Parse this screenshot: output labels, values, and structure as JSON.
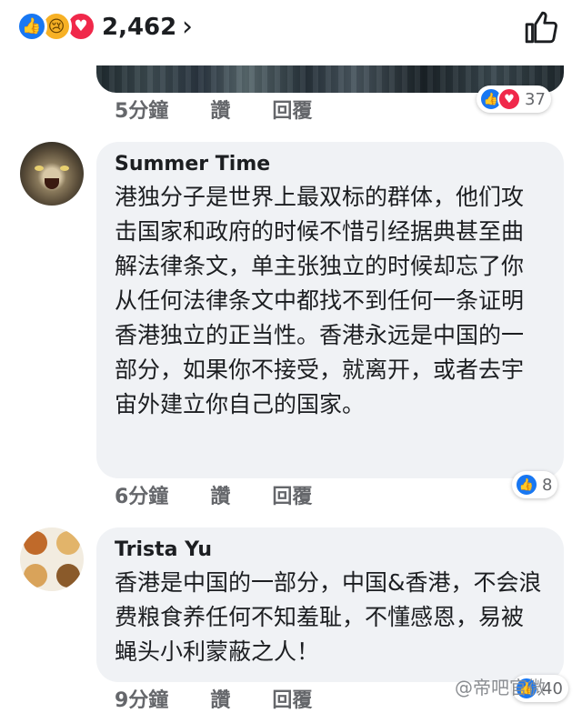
{
  "reactions_bar": {
    "icons": [
      "like-icon",
      "sad-icon",
      "love-icon"
    ],
    "count": "2,462",
    "chevron": "›"
  },
  "prev_comment": {
    "time": "5分鐘",
    "like_label": "讚",
    "reply_label": "回覆",
    "reaction_count": "37"
  },
  "comments": [
    {
      "author": "Summer Time",
      "text": "港独分子是世界上最双标的群体，他们攻击国家和政府的时候不惜引经据典甚至曲解法律条文，单主张独立的时候却忘了你从任何法律条文中都找不到任何一条证明香港独立的正当性。香港永远是中国的一部分，如果你不接受，就离开，或者去宇宙外建立你自己的国家。",
      "time": "6分鐘",
      "like_label": "讚",
      "reply_label": "回覆",
      "reaction_count": "8"
    },
    {
      "author": "Trista Yu",
      "text": "香港是中国的一部分，中国&香港，不会浪费粮食养任何不知羞耻，不懂感恩，易被蝇头小利蒙蔽之人！",
      "time": "9分鐘",
      "like_label": "讚",
      "reply_label": "回覆",
      "reaction_count": "40"
    }
  ],
  "watermark": "@帝吧官微"
}
